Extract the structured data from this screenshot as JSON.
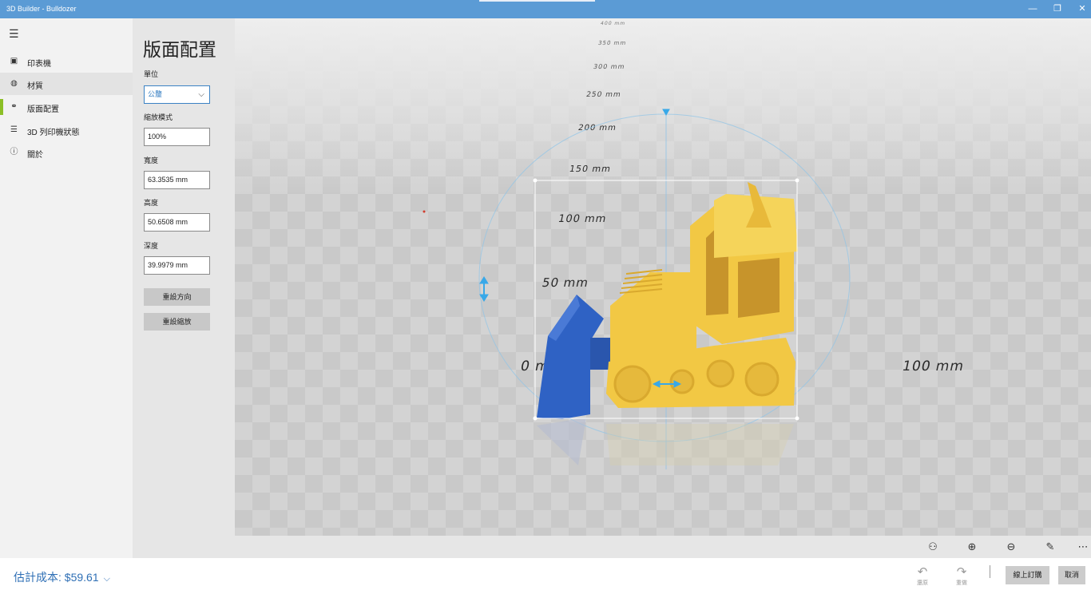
{
  "window": {
    "title": "3D Builder - Bulldozer",
    "minimize_glyph": "—",
    "maximize_glyph": "❐",
    "close_glyph": "✕"
  },
  "nav": {
    "menu_icon": "☰",
    "items": [
      {
        "label": "印表機",
        "icon": "printer-icon",
        "glyph": "▣"
      },
      {
        "label": "材質",
        "icon": "palette-icon",
        "glyph": "◍"
      },
      {
        "label": "版面配置",
        "icon": "layout-icon",
        "glyph": "⚭"
      },
      {
        "label": "3D 列印機狀態",
        "icon": "list-icon",
        "glyph": "☰"
      },
      {
        "label": "關於",
        "icon": "info-icon",
        "glyph": "ⓘ"
      }
    ],
    "selected_index": 2,
    "selected_color": "#8cbf26"
  },
  "panel": {
    "title": "版面配置",
    "unit_label": "單位",
    "unit_value": "公釐",
    "unit_chevron": "⌵",
    "scale_label": "縮放模式",
    "scale_value": "100%",
    "width_label": "寬度",
    "width_value": "63.3535 mm",
    "height_label": "高度",
    "height_value": "50.6508 mm",
    "depth_label": "深度",
    "depth_value": "39.9979 mm",
    "reset_orientation": "重設方向",
    "reset_scale": "重設縮放"
  },
  "viewport": {
    "rulers": [
      {
        "label": "400 mm"
      },
      {
        "label": "350 mm"
      },
      {
        "label": "300 mm"
      },
      {
        "label": "250 mm"
      },
      {
        "label": "200 mm"
      },
      {
        "label": "150 mm"
      },
      {
        "label": "100 mm"
      },
      {
        "label": "50 mm"
      },
      {
        "label": "0 mm"
      },
      {
        "label": "100 mm"
      }
    ],
    "colors": {
      "body": "#f2c844",
      "blade": "#2f62c4",
      "selection": "#ffffff",
      "gizmo": "#38a8e8"
    }
  },
  "toolbar": {
    "icons": [
      {
        "name": "view-icon",
        "glyph": "⚇"
      },
      {
        "name": "zoom-in-icon",
        "glyph": "⊕"
      },
      {
        "name": "zoom-out-icon",
        "glyph": "⊖"
      },
      {
        "name": "pen-icon",
        "glyph": "✎"
      },
      {
        "name": "more-icon",
        "glyph": "⋯"
      }
    ]
  },
  "footer": {
    "cost_label": "估計成本: $59.61",
    "cost_chevron": "⌵",
    "undo_label": "還原",
    "undo_glyph": "↶",
    "redo_label": "重做",
    "redo_glyph": "↷",
    "order_online": "線上訂購",
    "cancel": "取消"
  }
}
